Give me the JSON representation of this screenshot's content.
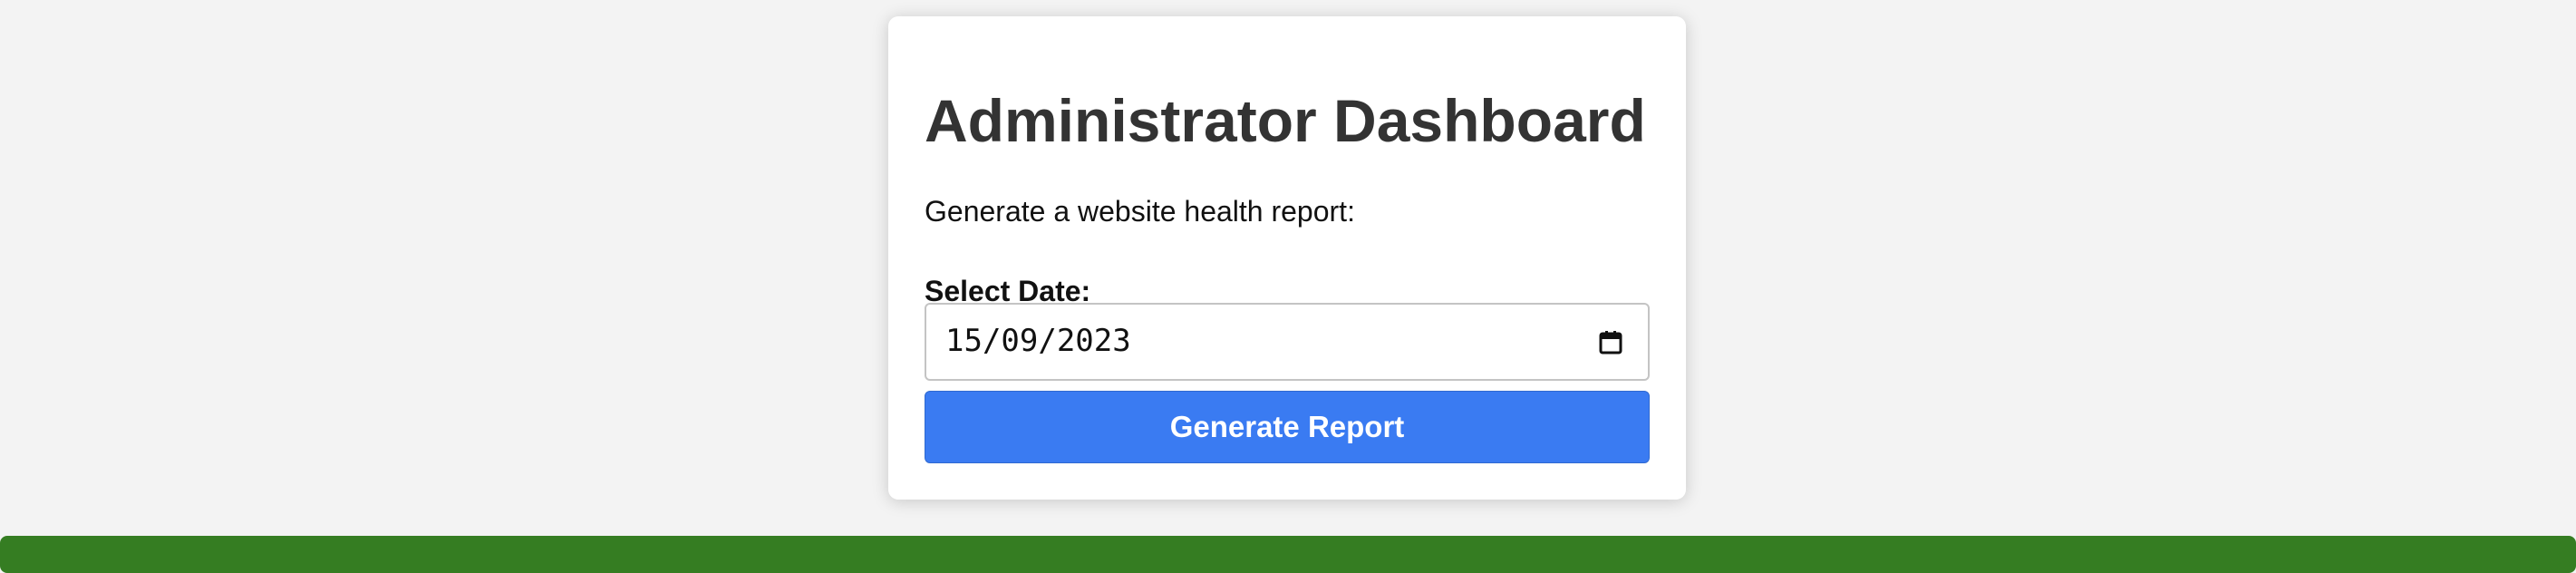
{
  "dashboard": {
    "title": "Administrator Dashboard",
    "description": "Generate a website health report:",
    "date_label": "Select Date:",
    "date_value": "15/09/2023",
    "generate_button_label": "Generate Report",
    "calendar_icon": "calendar-icon"
  },
  "colors": {
    "page_background": "#f3f3f3",
    "card_background": "#ffffff",
    "title_text": "#333333",
    "primary_button": "#3a7bf2",
    "footer_bar": "#357d22"
  }
}
